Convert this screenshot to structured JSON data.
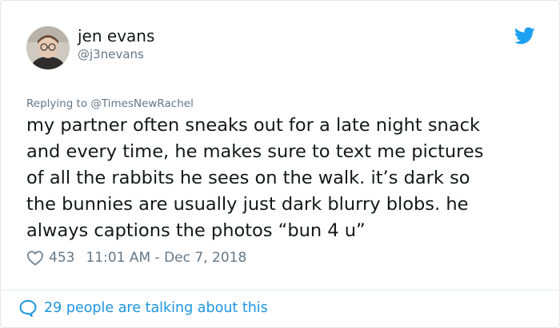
{
  "tweet": {
    "author": {
      "display_name": "jen evans",
      "handle": "@j3nevans",
      "avatar_icon": "profile-photo"
    },
    "reply_to": {
      "prefix": "Replying to ",
      "mention": "@TimesNewRachel"
    },
    "text": "my partner often sneaks out for a late night snack\nand every time, he makes sure to text me pictures\nof all the rabbits he sees on the walk. it’s dark so\nthe bunnies are usually just dark blurry blobs. he\nalways captions the photos “bun 4 u”",
    "likes": "453",
    "timestamp": "11:01 AM - Dec 7, 2018",
    "footer_text": "29 people are talking about this"
  },
  "colors": {
    "brand": "#1da1f2",
    "link": "#1b95e0",
    "text_primary": "#14171a",
    "text_secondary": "#657786",
    "border": "#e1e8ed"
  },
  "icons": {
    "brand": "twitter-bird-icon",
    "like": "heart-icon",
    "conversation": "speech-bubble-icon"
  }
}
